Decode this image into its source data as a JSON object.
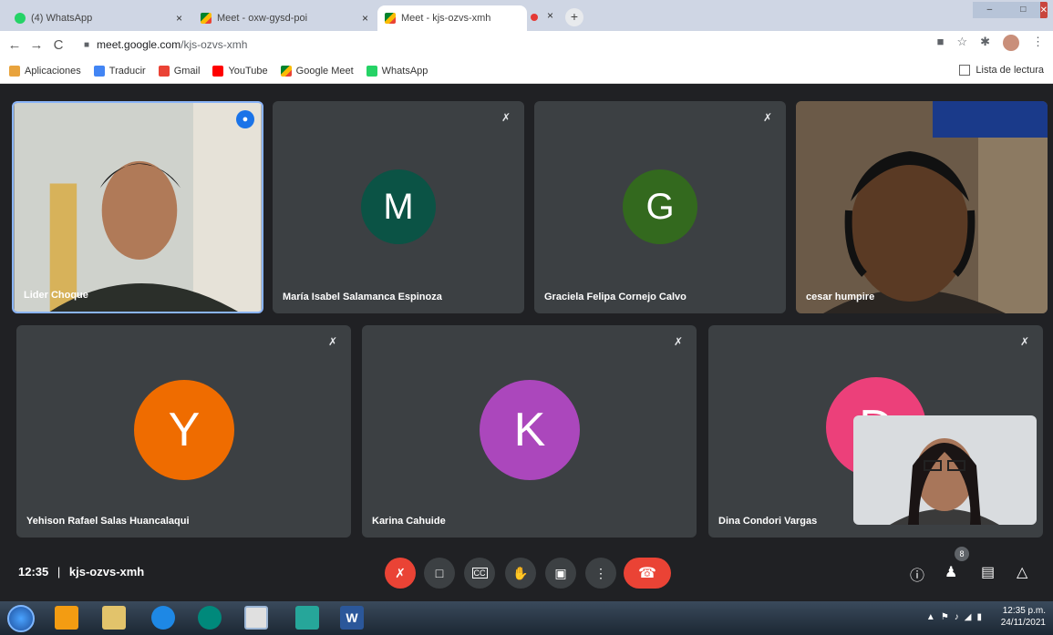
{
  "browser": {
    "tabs": [
      {
        "title": "(4) WhatsApp",
        "icon": "whatsapp-icon"
      },
      {
        "title": "Meet - oxw-gysd-poi",
        "icon": "meet-icon"
      },
      {
        "title": "Meet - kjs-ozvs-xmh",
        "icon": "meet-icon",
        "active": true
      }
    ],
    "close_glyph": "×",
    "new_tab": "+",
    "url_host": "meet.google.com",
    "url_path": "/kjs-ozvs-xmh",
    "bookmarks": [
      {
        "label": "Aplicaciones",
        "color": "#e8a33d"
      },
      {
        "label": "Traducir",
        "color": "#4285f4"
      },
      {
        "label": "Gmail",
        "color": "#ea4335"
      },
      {
        "label": "YouTube",
        "color": "#ff0000"
      },
      {
        "label": "Google Meet",
        "color": "#00832d"
      },
      {
        "label": "WhatsApp",
        "color": "#25d366"
      }
    ],
    "reading_list": "Lista de lectura"
  },
  "meet": {
    "participants": [
      {
        "name": "Lider Choque",
        "type": "video",
        "speaking": true
      },
      {
        "name": "María Isabel Salamanca Espinoza",
        "initial": "M",
        "color": "#0b5345"
      },
      {
        "name": "Graciela Felipa Cornejo Calvo",
        "initial": "G",
        "color": "#33691e"
      },
      {
        "name": "cesar humpire",
        "type": "video"
      },
      {
        "name": "Yehison Rafael Salas Huancalaqui",
        "initial": "Y",
        "color": "#ef6c00"
      },
      {
        "name": "Karina Cahuide",
        "initial": "K",
        "color": "#ab47bc"
      },
      {
        "name": "Dina Condori Vargas",
        "initial": "D",
        "color": "#ec407a"
      }
    ],
    "time": "12:35",
    "separator": "|",
    "code": "kjs-ozvs-xmh",
    "participant_count": "8"
  },
  "taskbar": {
    "time": "12:35 p.m.",
    "date": "24/11/2021"
  }
}
